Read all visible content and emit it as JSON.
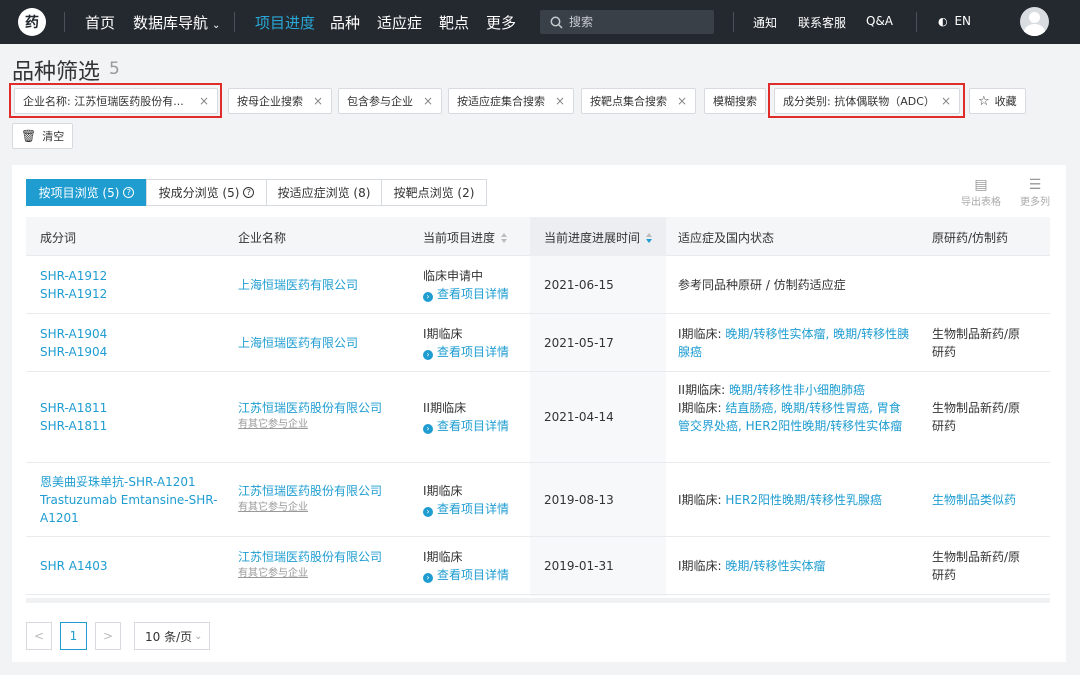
{
  "nav": {
    "logo_text": "药",
    "items": [
      "首页",
      "数据库导航",
      "项目进度",
      "品种",
      "适应症",
      "靶点",
      "更多"
    ],
    "active_index": 2,
    "search_placeholder": "搜索",
    "links": [
      "通知",
      "联系客服",
      "Q&A"
    ],
    "lang": "EN"
  },
  "page": {
    "title": "品种筛选",
    "count": "5"
  },
  "filters": {
    "company": "企业名称: 江苏恒瑞医药股份有...",
    "by_parent": "按母企业搜索",
    "include_participant": "包含参与企业",
    "by_indication_set": "按适应症集合搜索",
    "by_target_set": "按靶点集合搜索",
    "fuzzy": "模糊搜索",
    "component_type": "成分类别: 抗体偶联物（ADC）",
    "favorite": "收藏",
    "clear": "清空"
  },
  "tabs": [
    {
      "label": "按项目浏览 (5)",
      "help": true
    },
    {
      "label": "按成分浏览 (5)",
      "help": true
    },
    {
      "label": "按适应症浏览 (8)",
      "help": false
    },
    {
      "label": "按靶点浏览 (2)",
      "help": false
    }
  ],
  "tools": {
    "export": "导出表格",
    "more_cols": "更多列"
  },
  "table": {
    "columns": [
      "成分词",
      "企业名称",
      "当前项目进度",
      "当前进度进展时间",
      "适应症及国内状态",
      "原研药/仿制药"
    ],
    "detail_label": "查看项目详情",
    "rows": [
      {
        "component": [
          "SHR-A1912",
          "SHR-A1912"
        ],
        "company": "上海恒瑞医药有限公司",
        "company_sub": "",
        "progress": "临床申请中",
        "date": "2021-06-15",
        "indication_prefix": "",
        "indication": "参考同品种原研 / 仿制药适应症",
        "type": ""
      },
      {
        "component": [
          "SHR-A1904",
          "SHR-A1904"
        ],
        "company": "上海恒瑞医药有限公司",
        "company_sub": "",
        "progress": "I期临床",
        "date": "2021-05-17",
        "indication_prefix": "I期临床: ",
        "indication": "晚期/转移性实体瘤, 晚期/转移性胰腺癌",
        "type": "生物制品新药/原研药"
      },
      {
        "component": [
          "SHR-A1811",
          "SHR-A1811"
        ],
        "company": "江苏恒瑞医药股份有限公司",
        "company_sub": "有其它参与企业",
        "progress": "II期临床",
        "date": "2021-04-14",
        "indication_lines": [
          {
            "prefix": "II期临床: ",
            "text": "晚期/转移性非小细胞肺癌"
          },
          {
            "prefix": "I期临床: ",
            "text": "结直肠癌, 晚期/转移性胃癌, 胃食管交界处癌, HER2阳性晚期/转移性实体瘤"
          }
        ],
        "type": "生物制品新药/原研药"
      },
      {
        "component": [
          "恩美曲妥珠单抗-SHR-A1201",
          "Trastuzumab Emtansine-SHR-A1201"
        ],
        "company": "江苏恒瑞医药股份有限公司",
        "company_sub": "有其它参与企业",
        "progress": "I期临床",
        "date": "2019-08-13",
        "indication_prefix": "I期临床: ",
        "indication": "HER2阳性晚期/转移性乳腺癌",
        "type": "生物制品类似药"
      },
      {
        "component": [
          "SHR A1403"
        ],
        "company": "江苏恒瑞医药股份有限公司",
        "company_sub": "有其它参与企业",
        "progress": "I期临床",
        "date": "2019-01-31",
        "indication_prefix": "I期临床: ",
        "indication": "晚期/转移性实体瘤",
        "type": "生物制品新药/原研药"
      }
    ]
  },
  "pagination": {
    "prev": "<",
    "current": "1",
    "next": ">",
    "page_size": "10 条/页"
  },
  "colors": {
    "nav_bg": "#24292f",
    "accent": "#1f9dd1",
    "highlight_box": "#e02b2b"
  }
}
